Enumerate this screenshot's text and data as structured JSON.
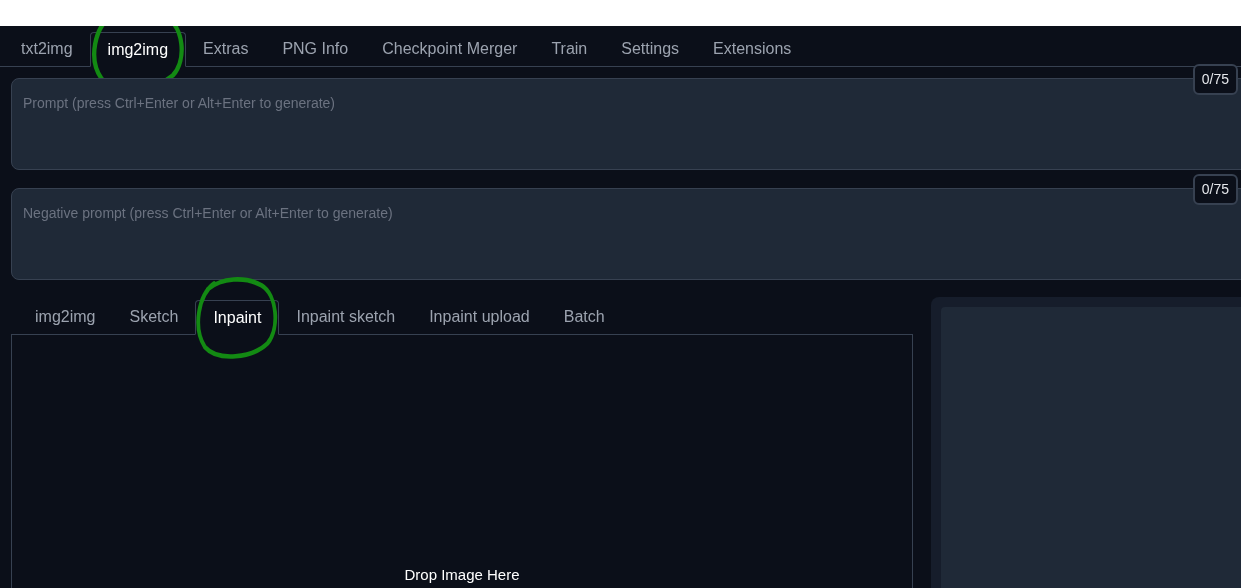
{
  "main_tabs": [
    {
      "label": "txt2img",
      "selected": false,
      "circled": false
    },
    {
      "label": "img2img",
      "selected": true,
      "circled": true
    },
    {
      "label": "Extras",
      "selected": false,
      "circled": false
    },
    {
      "label": "PNG Info",
      "selected": false,
      "circled": false
    },
    {
      "label": "Checkpoint Merger",
      "selected": false,
      "circled": false
    },
    {
      "label": "Train",
      "selected": false,
      "circled": false
    },
    {
      "label": "Settings",
      "selected": false,
      "circled": false
    },
    {
      "label": "Extensions",
      "selected": false,
      "circled": false
    }
  ],
  "prompts": [
    {
      "placeholder": "Prompt (press Ctrl+Enter or Alt+Enter to generate)",
      "token_count": "0/75"
    },
    {
      "placeholder": "Negative prompt (press Ctrl+Enter or Alt+Enter to generate)",
      "token_count": "0/75"
    }
  ],
  "mode_tabs": [
    {
      "label": "img2img",
      "selected": false,
      "circled": false
    },
    {
      "label": "Sketch",
      "selected": false,
      "circled": false
    },
    {
      "label": "Inpaint",
      "selected": true,
      "circled": true
    },
    {
      "label": "Inpaint sketch",
      "selected": false,
      "circled": false
    },
    {
      "label": "Inpaint upload",
      "selected": false,
      "circled": false
    },
    {
      "label": "Batch",
      "selected": false,
      "circled": false
    }
  ],
  "image_drop": {
    "label": "Drop Image Here"
  }
}
